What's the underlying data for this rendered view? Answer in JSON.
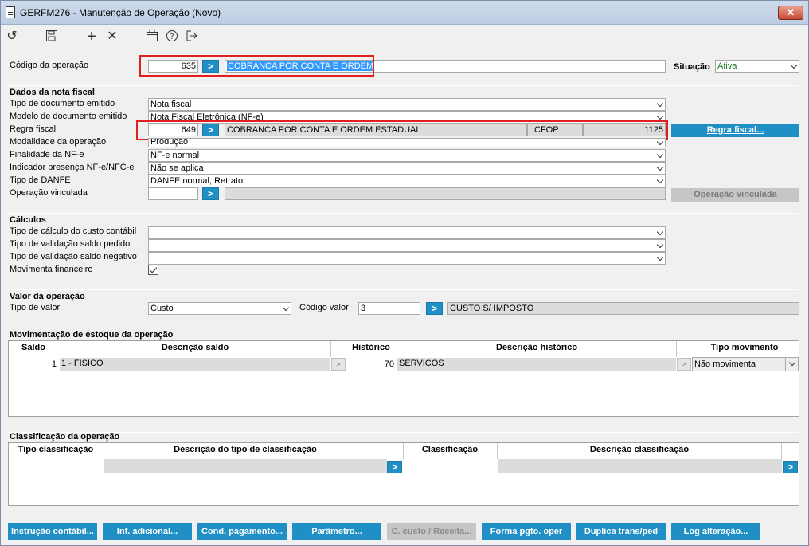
{
  "window": {
    "title": "GERFM276 - Manutenção de Operação (Novo)",
    "close": "✕"
  },
  "toolbar": {
    "undo": "↺",
    "save": "💾",
    "add": "+",
    "delete": "✕",
    "calendar": "📅",
    "help": "?",
    "exit": "↦"
  },
  "header": {
    "codigo_label": "Código da operação",
    "codigo_value": "635",
    "codigo_desc": "COBRANCA POR CONTA E ORDEM",
    "situacao_label": "Situação",
    "situacao_value": "Ativa",
    "go": ">"
  },
  "nota": {
    "title": "Dados da nota fiscal",
    "tipo_doc_label": "Tipo de documento emitido",
    "tipo_doc_value": "Nota fiscal",
    "modelo_label": "Modelo de documento emitido",
    "modelo_value": "Nota Fiscal Eletrônica (NF-e)",
    "regra_label": "Regra fiscal",
    "regra_code": "649",
    "regra_desc": "COBRANCA POR CONTA E ORDEM ESTADUAL",
    "cfop_label": "CFOP",
    "cfop_value": "1125",
    "regra_btn": "Regra fiscal...",
    "modalidade_label": "Modalidade da operação",
    "modalidade_value": "Produção",
    "finalidade_label": "Finalidade da NF-e",
    "finalidade_value": "NF-e normal",
    "indicador_label": "Indicador presença NF-e/NFC-e",
    "indicador_value": "Não se aplica",
    "danfe_label": "Tipo de DANFE",
    "danfe_value": "DANFE normal, Retrato",
    "vinculada_label": "Operação vinculada",
    "vinculada_btn": "Operação vinculada"
  },
  "calculos": {
    "title": "Cálculos",
    "custo_label": "Tipo de cálculo do custo contábil",
    "saldo_pedido_label": "Tipo de validação saldo pedido",
    "saldo_negativo_label": "Tipo de validação saldo negativo",
    "financeiro_label": "Movimenta financeiro"
  },
  "valor": {
    "title": "Valor da operação",
    "tipo_label": "Tipo de valor",
    "tipo_value": "Custo",
    "codigo_label": "Código valor",
    "codigo_value": "3",
    "codigo_desc": "CUSTO S/ IMPOSTO"
  },
  "estoque": {
    "title": "Movimentação de estoque da operação",
    "headers": [
      "Saldo",
      "Descrição saldo",
      "Histórico",
      "Descrição histórico",
      "Tipo movimento"
    ],
    "row": {
      "saldo": "1",
      "desc_saldo": "1 - FISICO",
      "historico": "70",
      "desc_hist": "SERVICOS",
      "tipo": "Não movimenta"
    }
  },
  "classificacao": {
    "title": "Classificação da operação",
    "headers": [
      "Tipo classificação",
      "Descrição do tipo de classificação",
      "Classificação",
      "Descrição classificação"
    ]
  },
  "buttons": {
    "instrucao": "Instrução contábil...",
    "inf": "Inf. adicional...",
    "cond": "Cond. pagamento...",
    "parametro": "Parâmetro...",
    "custo_receita": "C. custo / Receita...",
    "forma": "Forma pgto. oper",
    "duplica": "Duplica trans/ped",
    "log": "Log alteração..."
  }
}
